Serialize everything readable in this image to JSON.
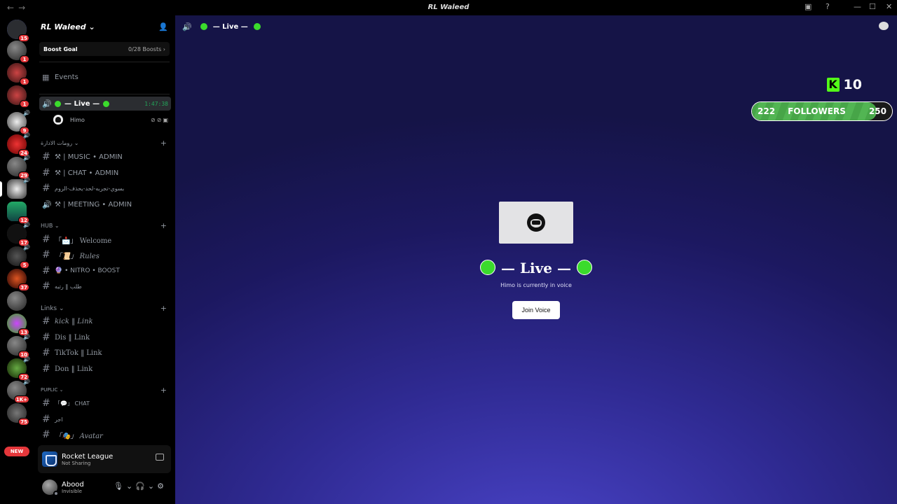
{
  "window": {
    "title": "RL Waleed",
    "nav_back": "←",
    "nav_fwd": "→",
    "help": "?",
    "minimize": "—",
    "maximize": "☐",
    "close": "✕"
  },
  "guilds": [
    {
      "badge": "15"
    },
    {
      "badge": "1"
    },
    {
      "badge": "1"
    },
    {
      "badge": "1"
    },
    {
      "badge": "9"
    },
    {
      "badge": "24"
    },
    {
      "badge": "29"
    },
    {
      "badge": ""
    },
    {
      "badge": "12"
    },
    {
      "badge": "17"
    },
    {
      "badge": "5"
    },
    {
      "badge": "37"
    },
    {
      "badge": ""
    },
    {
      "badge": "13"
    },
    {
      "badge": "10"
    },
    {
      "badge": "72"
    },
    {
      "badge": "1K+"
    },
    {
      "badge": "75"
    }
  ],
  "guild_new_label": "NEW",
  "server": {
    "name": "RL Waleed",
    "boost_label": "Boost Goal",
    "boost_value": "0/28 Boosts",
    "events_label": "Events"
  },
  "voice_channel": {
    "name": "— Live —",
    "time": "1:47:38",
    "user": "Himo"
  },
  "categories": {
    "admin": "رومات الادارة",
    "hub": "HUB",
    "links": "Links",
    "puplic": "PUPLIC"
  },
  "channels": {
    "music_admin": "⚒ | MUSIC • ADMIN",
    "chat_admin": "⚒ | CHAT • ADMIN",
    "arabic1": "بسوي-تجربه-لحد-يحذف-الروم",
    "meeting_admin": "⚒ | MEETING • ADMIN",
    "welcome": "「📩」 Welcome",
    "rules": "「📜」 Rules",
    "nitro_boost": "🔮 • NITRO • BOOST",
    "arabic2": "طلب ‖ رتبه",
    "kick_link": "kick ‖ Link",
    "dis_link": "Dis ‖ Link",
    "tiktok_link": "TikTok ‖ Link",
    "don_link": "Don ‖ Link",
    "chat": "「💬」 CHAT",
    "arabic3": "اجر",
    "avatar": "「🎭」 Avatar"
  },
  "activity": {
    "game": "Rocket League",
    "status": "Not Sharing"
  },
  "user": {
    "name": "Abood",
    "status": "Invisible"
  },
  "main": {
    "header_title": "— Live —",
    "kick_count": "10",
    "kick_logo": "K",
    "followers_current": "222",
    "followers_label": "FOLLOWERS",
    "followers_goal": "250",
    "followers_progress": 0.888,
    "live_title": "— Live —",
    "live_subtitle": "Himo is currently in voice",
    "join_button": "Join Voice"
  },
  "colors": {
    "live_dot": "#3bdb2c",
    "kick_green": "#53fc18",
    "badge_red": "#e5373b",
    "main_bg": "#2f2a92"
  }
}
